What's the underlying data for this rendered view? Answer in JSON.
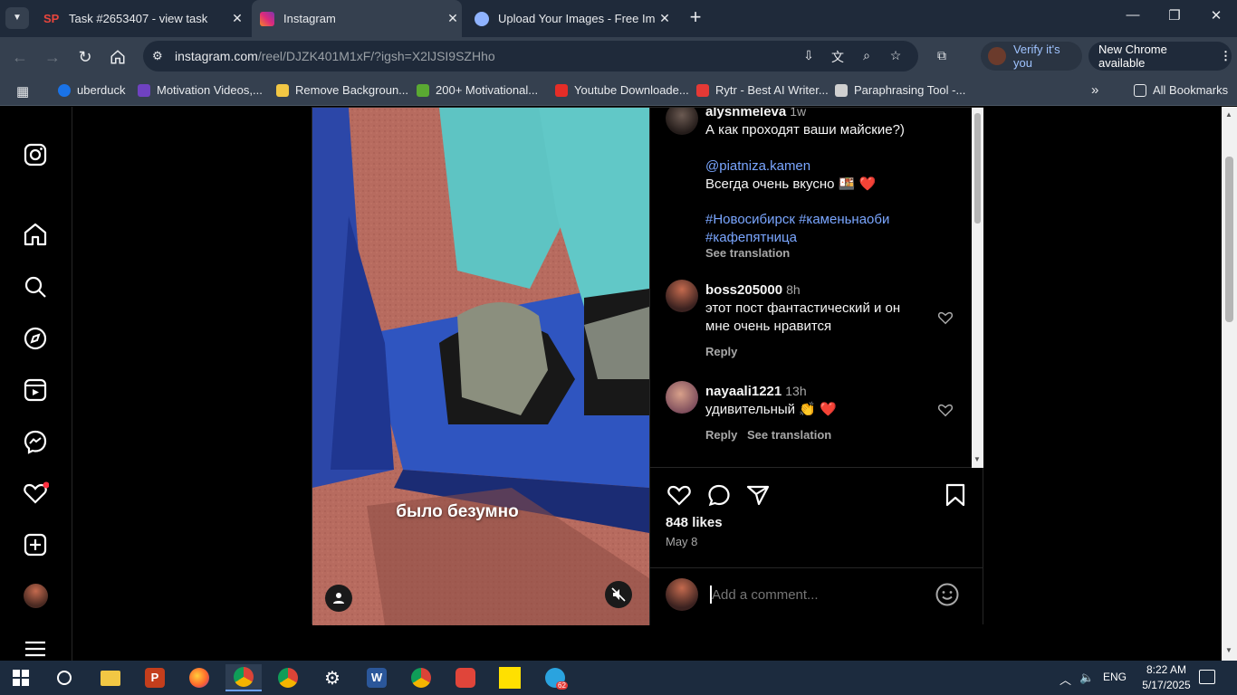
{
  "browser": {
    "tabs": [
      {
        "title": "Task #2653407 - view task",
        "favicon": "sp-icon",
        "active": false
      },
      {
        "title": "Instagram",
        "favicon": "instagram-icon",
        "active": true
      },
      {
        "title": "Upload Your Images - Free Imag",
        "favicon": "upload-icon",
        "active": false
      }
    ],
    "url_host": "instagram.com",
    "url_path": "/reel/DJZK401M1xF/?igsh=X2lJSI9SZHho",
    "verify_label": "Verify it's you",
    "new_chrome_label": "New Chrome available",
    "bookmarks": [
      {
        "label": "uberduck",
        "color": "#1a73e8"
      },
      {
        "label": "Motivation Videos,...",
        "color": "#6f42c1"
      },
      {
        "label": "Remove Backgroun...",
        "color": "#f2c744"
      },
      {
        "label": "200+ Motivational...",
        "color": "#5aa932"
      },
      {
        "label": "Youtube Downloade...",
        "color": "#e52d27"
      },
      {
        "label": "Rytr - Best AI Writer...",
        "color": "#e53935"
      },
      {
        "label": "Paraphrasing Tool -...",
        "color": "#d0d0d0"
      }
    ],
    "all_bookmarks_label": "All Bookmarks"
  },
  "video": {
    "caption": "было безумно"
  },
  "comments": {
    "first": {
      "user": "alysnmeleva",
      "time": "1w",
      "line1": "А как проходят ваши майские?)",
      "mention": "@piatniza.kamen",
      "line2": "Всегда очень вкусно 🍱 ❤️",
      "hashtags1": "#Новосибирск #каменьнаоби",
      "hashtags2": "#кафепятница",
      "see_translation": "See translation"
    },
    "items": [
      {
        "user": "boss205000",
        "time": "8h",
        "text1": "этот пост фантастический и он",
        "text2": "мне очень нравится",
        "reply": "Reply",
        "translation": ""
      },
      {
        "user": "nayaali1221",
        "time": "13h",
        "text1": "удивительный 👏 ❤️",
        "text2": "",
        "reply": "Reply",
        "translation": "See translation"
      }
    ]
  },
  "post": {
    "likes": "848 likes",
    "date": "May 8",
    "comment_placeholder": "Add a comment..."
  },
  "taskbar": {
    "telegram_badge": "62",
    "lang": "ENG",
    "time": "8:22 AM",
    "date": "5/17/2025"
  }
}
